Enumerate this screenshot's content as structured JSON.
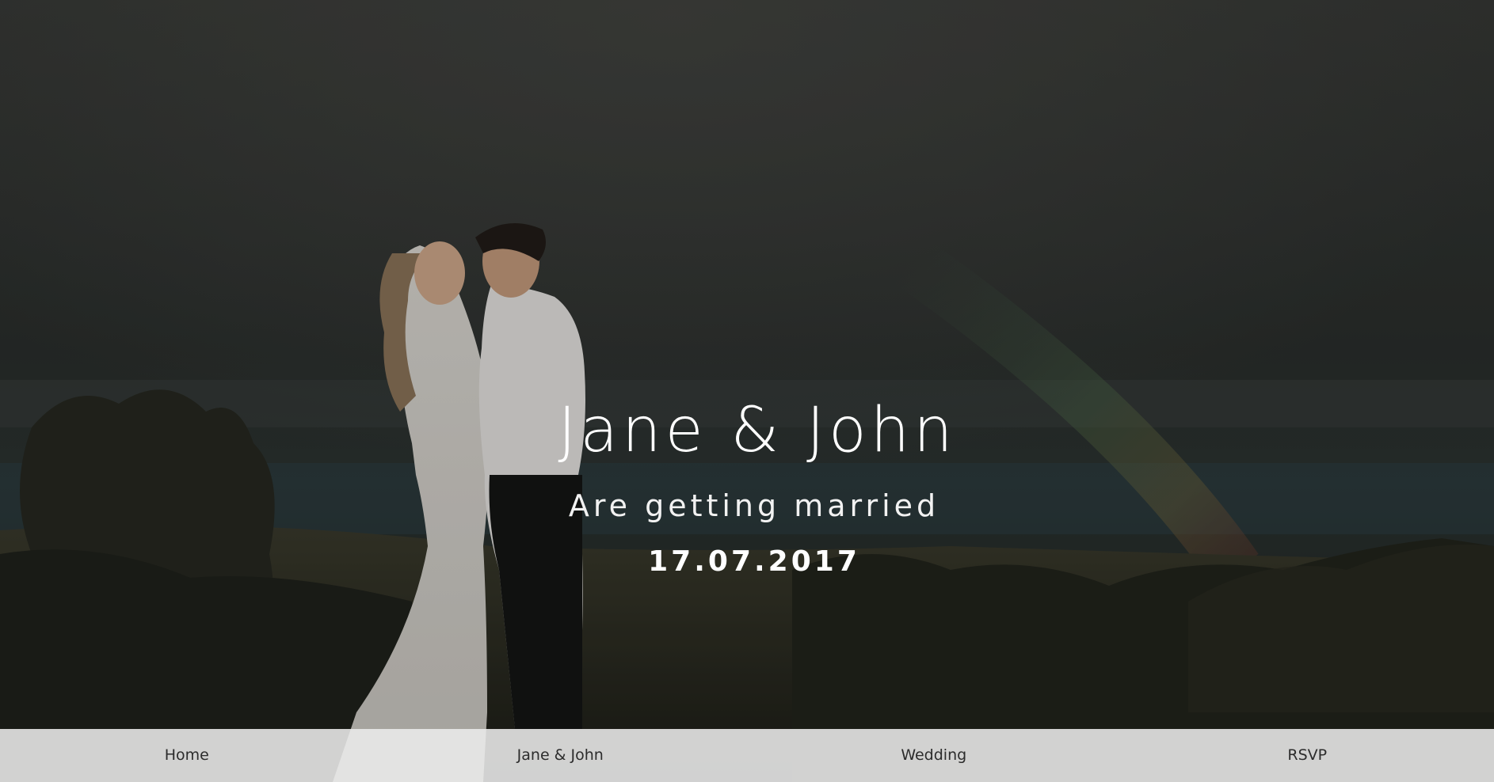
{
  "hero": {
    "title": "Jane & John",
    "subtitle": "Are getting married",
    "date": "17.07.2017",
    "image": "couple-kissing-photo"
  },
  "nav": {
    "items": [
      {
        "label": "Home"
      },
      {
        "label": "Jane & John"
      },
      {
        "label": "Wedding"
      },
      {
        "label": "RSVP"
      }
    ]
  },
  "colors": {
    "overlay_text": "#ffffff",
    "nav_background": "#ececec",
    "nav_text": "#2c2c2c"
  }
}
